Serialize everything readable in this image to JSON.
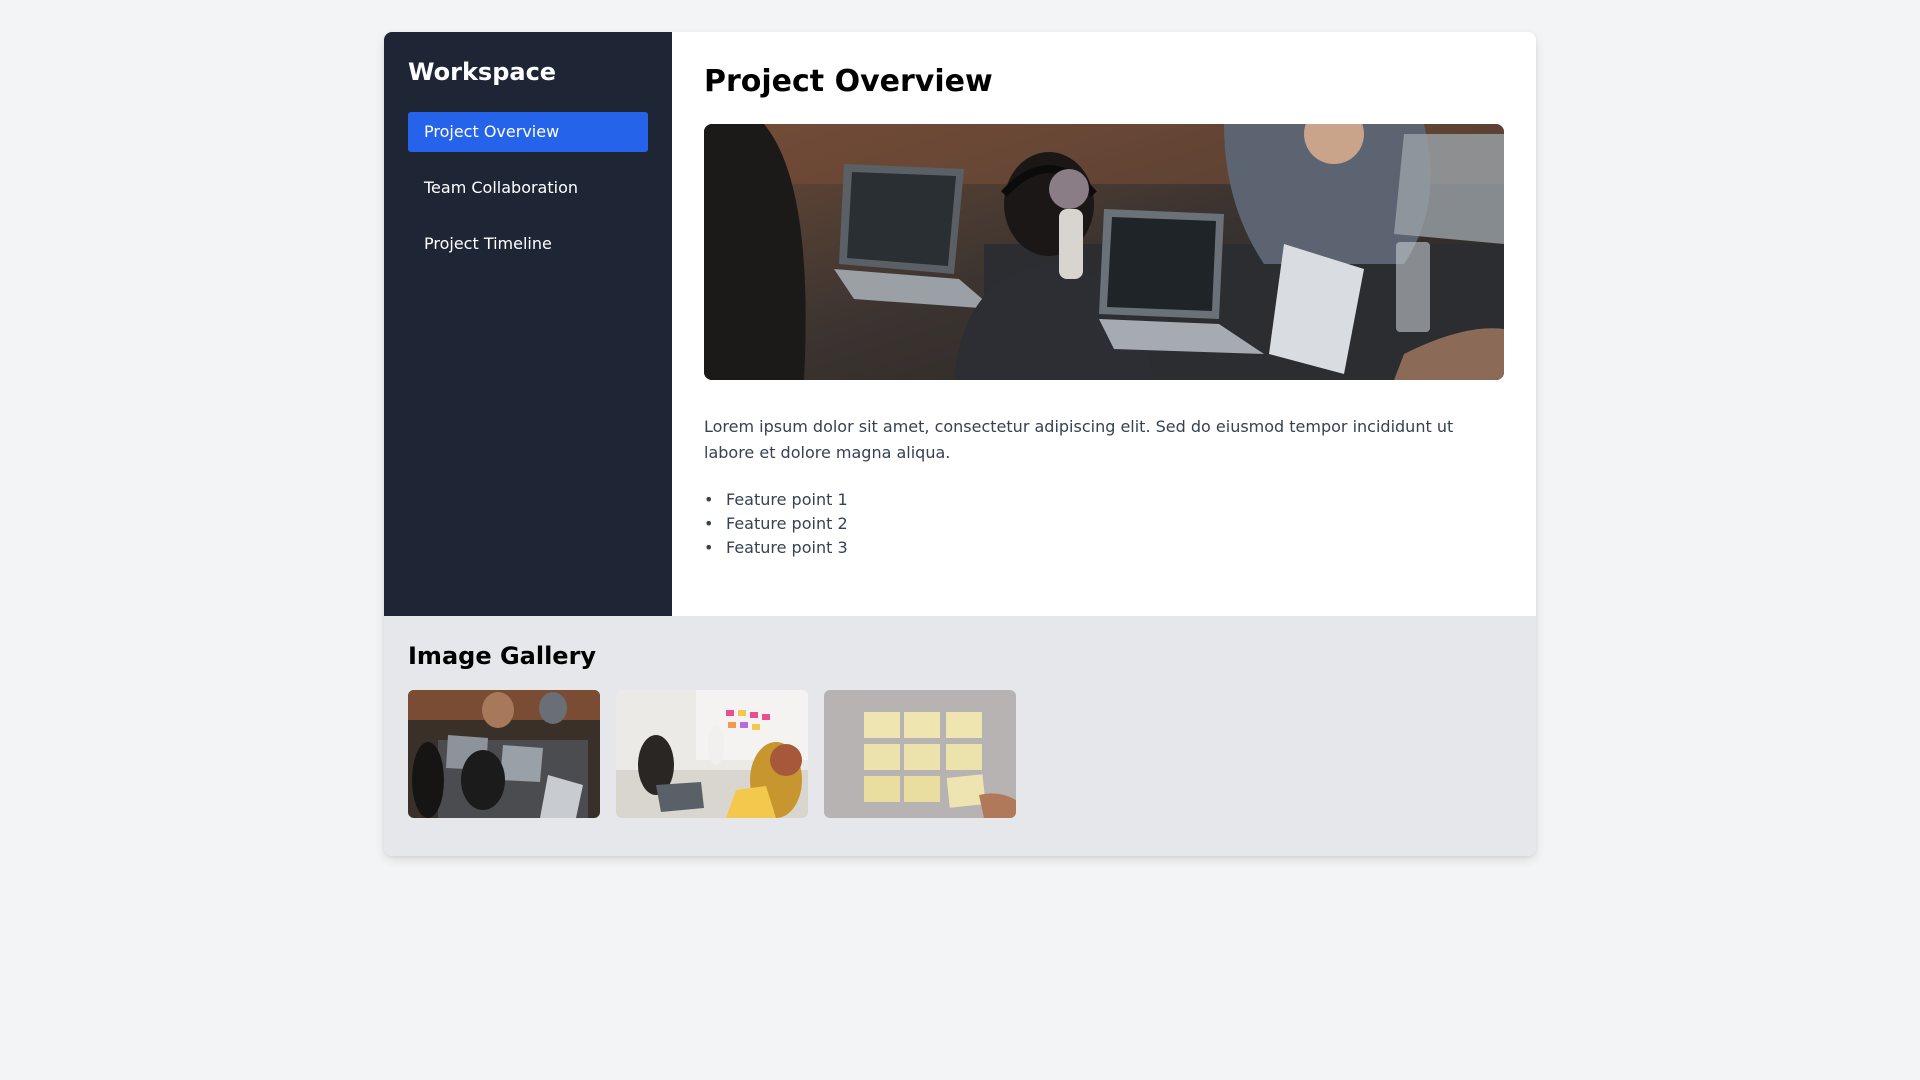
{
  "sidebar": {
    "title": "Workspace",
    "items": [
      {
        "label": "Project Overview",
        "active": true
      },
      {
        "label": "Team Collaboration",
        "active": false
      },
      {
        "label": "Project Timeline",
        "active": false
      }
    ]
  },
  "main": {
    "title": "Project Overview",
    "description": "Lorem ipsum dolor sit amet, consectetur adipiscing elit. Sed do eiusmod tempor incididunt ut labore et dolore magna aliqua.",
    "features": [
      "Feature point 1",
      "Feature point 2",
      "Feature point 3"
    ]
  },
  "gallery": {
    "title": "Image Gallery"
  },
  "colors": {
    "sidebar_bg": "#1e2636",
    "accent": "#2563eb",
    "page_bg": "#f3f4f6",
    "gallery_bg": "#e5e7eb"
  }
}
